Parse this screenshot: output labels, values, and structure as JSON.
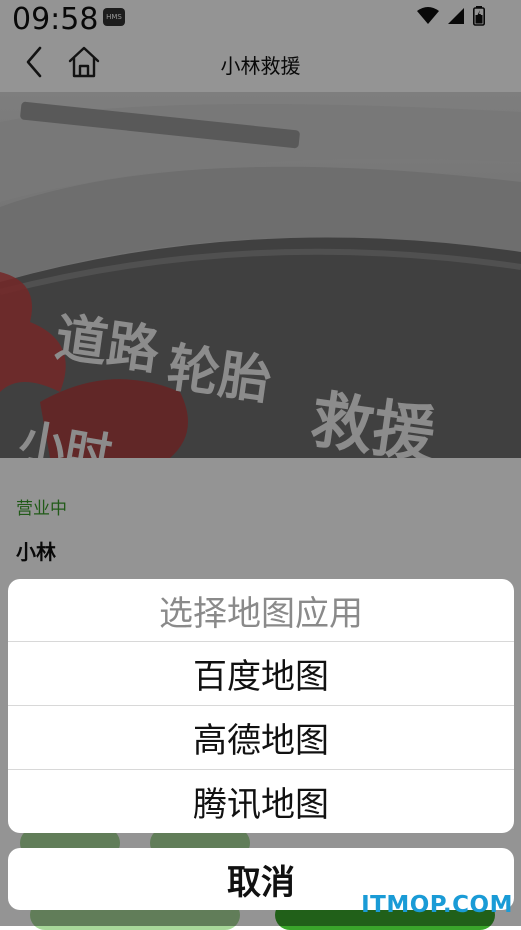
{
  "status_bar": {
    "time": "09:58",
    "hms_badge": "HMS"
  },
  "header": {
    "title": "小林救援"
  },
  "banner": {
    "sign_text": [
      "道路",
      "轮胎",
      "救援",
      "小时"
    ]
  },
  "shop": {
    "status": "营业中",
    "name": "小林"
  },
  "action_sheet": {
    "title": "选择地图应用",
    "options": [
      "百度地图",
      "高德地图",
      "腾讯地图"
    ],
    "cancel_label": "取消"
  },
  "watermark": "ITMOP.COM",
  "colors": {
    "accent_green": "#3a9b2a",
    "watermark_blue": "#1a9bd6"
  }
}
